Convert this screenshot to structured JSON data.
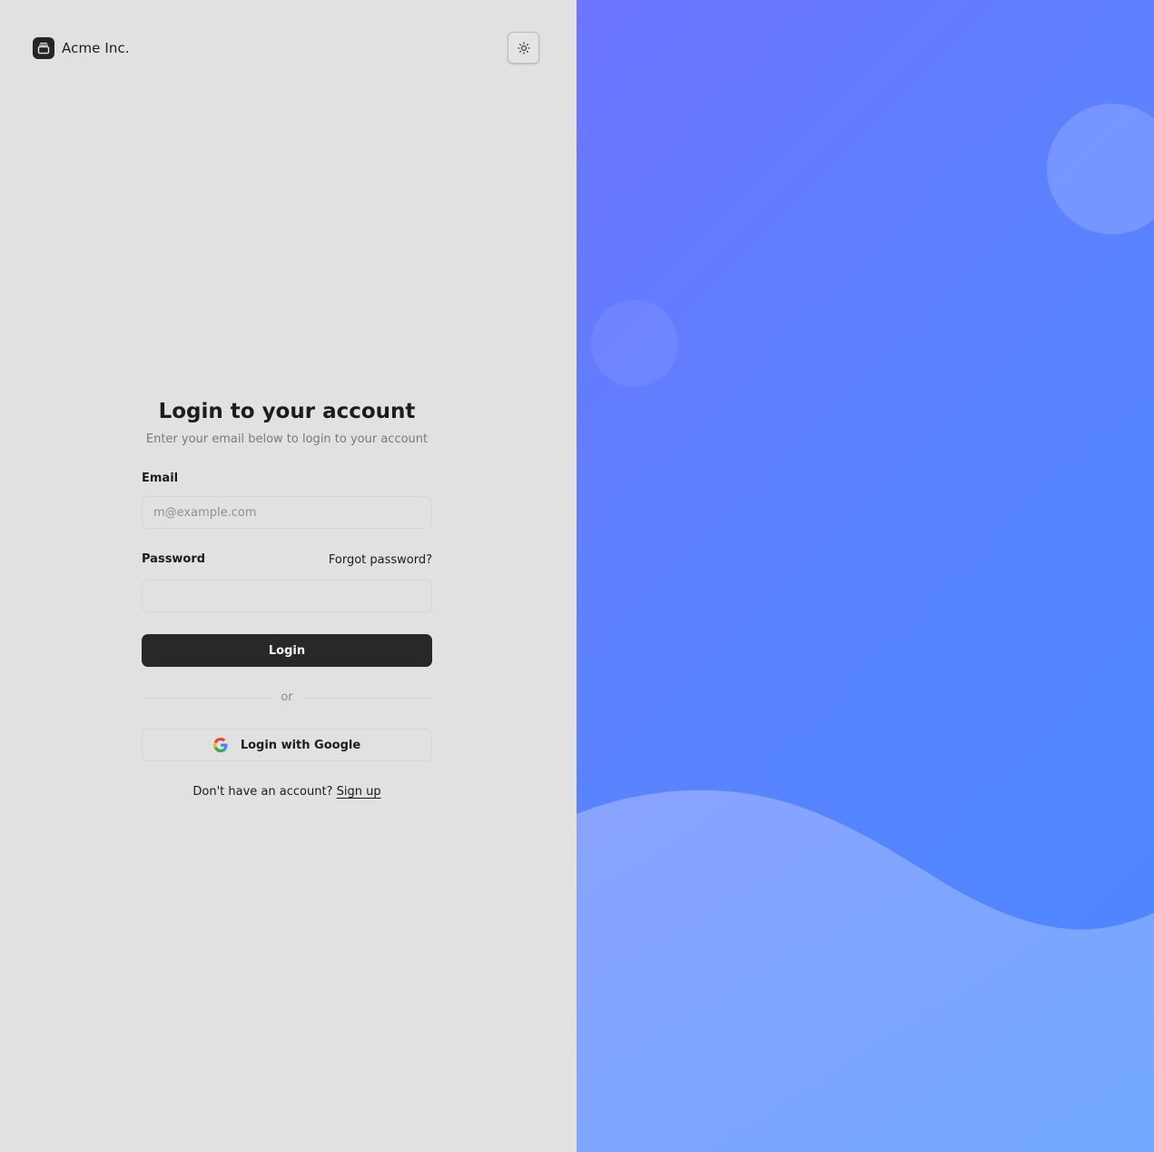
{
  "brand": {
    "name": "Acme Inc.",
    "logo_icon": "gallery-stack-icon"
  },
  "header": {
    "theme_toggle_icon": "sun-icon"
  },
  "form": {
    "title": "Login to your account",
    "subtitle": "Enter your email below to login to your account",
    "email_label": "Email",
    "email_placeholder": "m@example.com",
    "email_value": "",
    "password_label": "Password",
    "forgot_password": "Forgot password?",
    "password_value": "",
    "login_button": "Login",
    "divider_text": "or",
    "google_button": "Login with Google",
    "google_icon": "google-icon",
    "signup_prompt": "Don't have an account?",
    "signup_link": "Sign up"
  },
  "colors": {
    "left_background": "#e1e1e1",
    "primary_button": "#282828",
    "gradient_start": "#6d74ff",
    "gradient_end": "#4a88ff"
  }
}
